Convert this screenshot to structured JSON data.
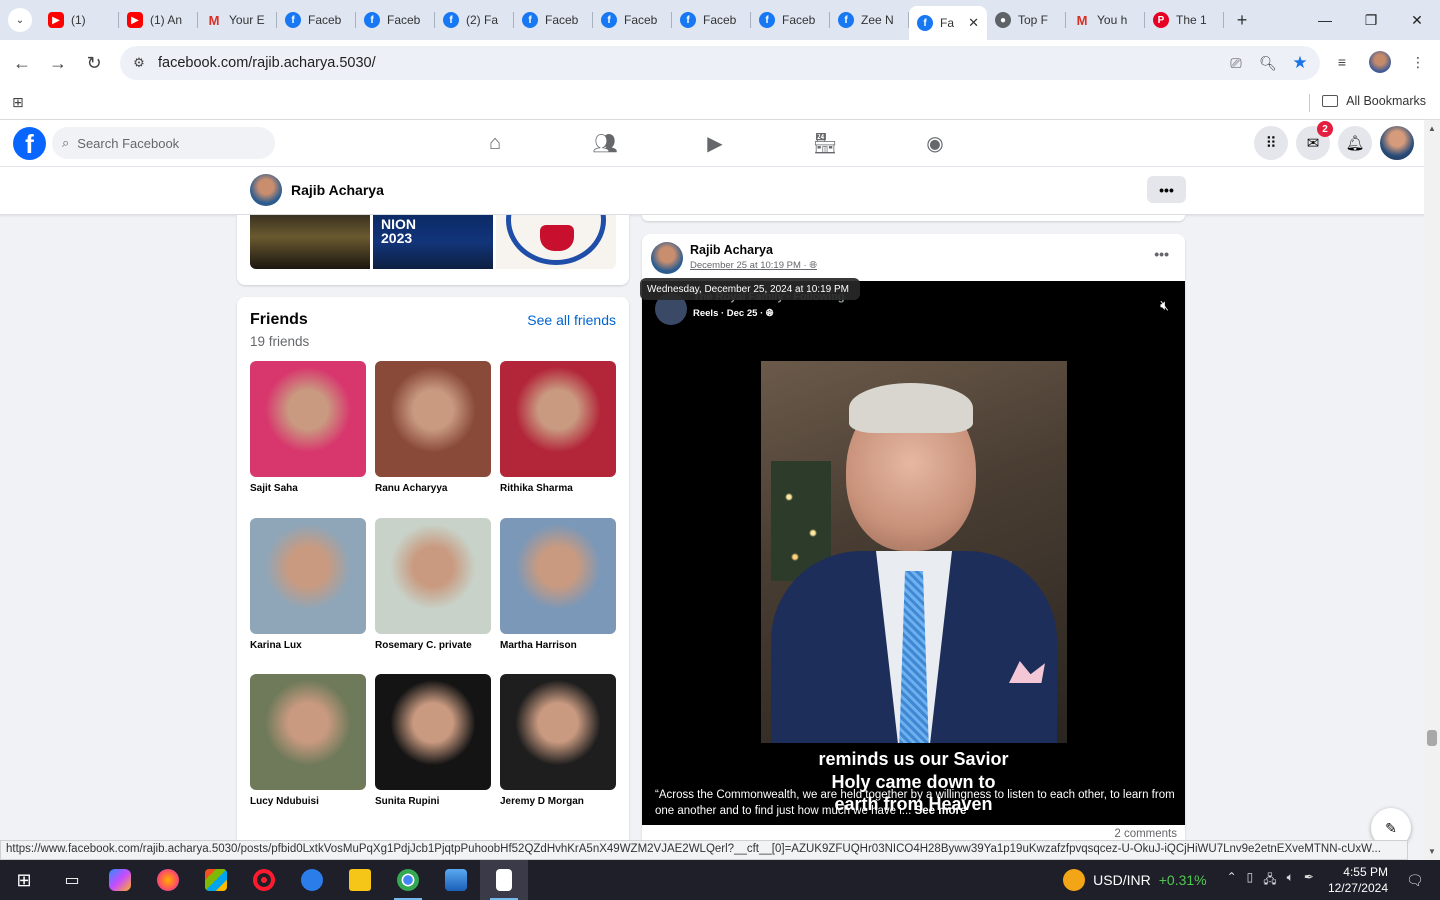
{
  "browser": {
    "tabs": [
      {
        "icon": "youtube",
        "title": "(1)"
      },
      {
        "icon": "youtube",
        "title": "(1) An"
      },
      {
        "icon": "gmail",
        "title": "Your E"
      },
      {
        "icon": "facebook",
        "title": "Faceb"
      },
      {
        "icon": "facebook",
        "title": "Faceb"
      },
      {
        "icon": "facebook",
        "title": "(2) Fa"
      },
      {
        "icon": "facebook",
        "title": "Faceb"
      },
      {
        "icon": "facebook",
        "title": "Faceb"
      },
      {
        "icon": "facebook",
        "title": "Faceb"
      },
      {
        "icon": "facebook",
        "title": "Faceb"
      },
      {
        "icon": "facebook",
        "title": "Zee N"
      },
      {
        "icon": "facebook",
        "title": "Fa",
        "active": true
      },
      {
        "icon": "google",
        "title": "Top F"
      },
      {
        "icon": "gmail",
        "title": "You h"
      },
      {
        "icon": "pinterest",
        "title": "The 1"
      }
    ],
    "url": "facebook.com/rajib.acharya.5030/",
    "bookmarks_label": "All Bookmarks",
    "status_url": "https://www.facebook.com/rajib.acharya.5030/posts/pfbid0LxtkVosMuPqXg1PdjJcb1PjqtpPuhoobHf52QZdHvhKrA5nX49WZM2VJAE2WLQerl?__cft__[0]=AZUK9ZFUQHr03NICO4H28Byww39Ya1p19uKwzafzfpvqsqcez-U-OkuJ-iQCjHiWU7Lnv9e2etnEXveMTNN-cUxW..."
  },
  "facebook": {
    "search_placeholder": "Search Facebook",
    "messenger_badge": "2",
    "profile_name": "Rajib Acharya",
    "photos_overlay_text": "NION\n2023",
    "friends": {
      "title": "Friends",
      "count": "19 friends",
      "see_all": "See all friends",
      "list": [
        {
          "name": "Sajit Saha",
          "color": "#d8376d"
        },
        {
          "name": "Ranu Acharyya",
          "color": "#8a4a3a"
        },
        {
          "name": "Rithika Sharma",
          "color": "#b3263a"
        },
        {
          "name": "Karina Lux",
          "color": "#8fa6b8"
        },
        {
          "name": "Rosemary C. private",
          "color": "#c8d2c8"
        },
        {
          "name": "Martha Harrison",
          "color": "#7b98b8"
        },
        {
          "name": "Lucy Ndubuisi",
          "color": "#6f7a5a"
        },
        {
          "name": "Sunita Rupini",
          "color": "#141414"
        },
        {
          "name": "Jeremy D Morgan",
          "color": "#1e1e1e"
        }
      ]
    },
    "post": {
      "author": "Rajib Acharya",
      "date": "December 25 at 10:19 PM",
      "tooltip": "Wednesday, December 25, 2024 at 10:19 PM",
      "video_source": "The Royal Family · Following",
      "video_meta": "Reels · Dec 25 ·",
      "subtitle_line1": "reminds us our Savior",
      "subtitle_line2": "Holy came down to",
      "subtitle_line3": "earth from Heaven",
      "caption": "“Across the Commonwealth, we are held together by a willingness to listen to each other, to learn from one another and to find just how much we have i...",
      "see_more": "See more",
      "comments": "2 comments"
    }
  },
  "taskbar": {
    "currency_label": "USD/INR",
    "currency_change": "+0.31%",
    "time": "4:55 PM",
    "date": "12/27/2024"
  }
}
